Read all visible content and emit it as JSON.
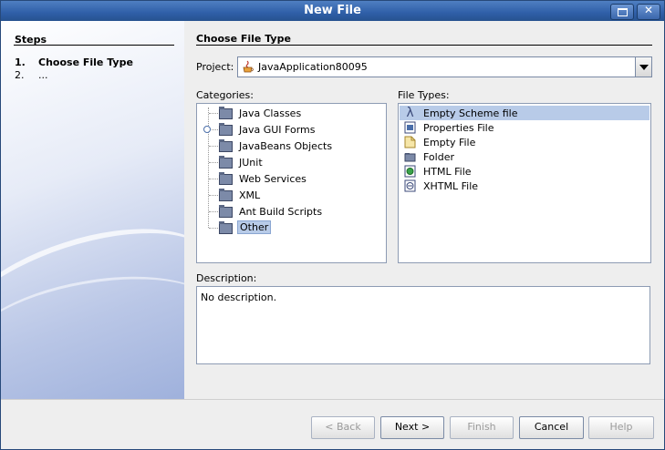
{
  "window": {
    "title": "New File"
  },
  "steps": {
    "title": "Steps",
    "items": [
      {
        "num": "1.",
        "label": "Choose File Type"
      },
      {
        "num": "2.",
        "label": "..."
      }
    ]
  },
  "main": {
    "title": "Choose File Type",
    "project_label": "Project:",
    "project_value": "JavaApplication80095",
    "categories_label": "Categories:",
    "file_types_label": "File Types:",
    "categories": [
      "Java Classes",
      "Java GUI Forms",
      "JavaBeans Objects",
      "JUnit",
      "Web Services",
      "XML",
      "Ant Build Scripts",
      "Other"
    ],
    "selected_category": "Other",
    "file_types": [
      {
        "label": "Empty Scheme file",
        "icon": "lambda-icon"
      },
      {
        "label": "Properties File",
        "icon": "properties-file-icon"
      },
      {
        "label": "Empty File",
        "icon": "empty-file-icon"
      },
      {
        "label": "Folder",
        "icon": "folder-icon"
      },
      {
        "label": "HTML File",
        "icon": "html-file-icon"
      },
      {
        "label": "XHTML File",
        "icon": "xhtml-file-icon"
      }
    ],
    "selected_file_type": "Empty Scheme file",
    "description_label": "Description:",
    "description": "No description."
  },
  "buttons": {
    "back": "< Back",
    "next": "Next >",
    "finish": "Finish",
    "cancel": "Cancel",
    "help": "Help"
  },
  "colors": {
    "titlebar": "#2f5fa8",
    "selection": "#b8cbe8"
  }
}
